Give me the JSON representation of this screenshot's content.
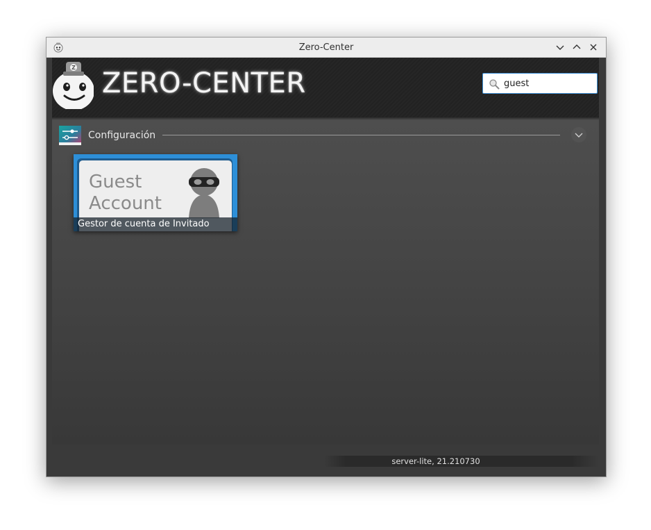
{
  "window": {
    "title": "Zero-Center",
    "buttons": {
      "minimize": "chevron-down-icon",
      "maximize": "chevron-up-icon",
      "close": "close-icon"
    }
  },
  "header": {
    "logo_text": "ZERO-CENTER",
    "mascot_badge": "Z"
  },
  "search": {
    "value": "guest",
    "icon": "search-icon"
  },
  "section": {
    "label": "Configuración",
    "icon": "settings-sliders-icon"
  },
  "tiles": [
    {
      "art_line1": "Guest",
      "art_line2": "Account",
      "caption": "Gestor de cuenta de Invitado"
    }
  ],
  "status": {
    "text": "server-lite, 21.210730"
  },
  "colors": {
    "accent": "#3d8fd6",
    "tile_blue": "#2d8fd8",
    "background_dark": "#3a3a3a"
  }
}
